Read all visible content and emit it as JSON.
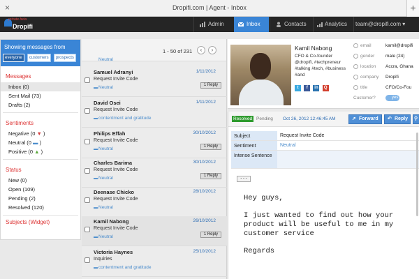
{
  "browser": {
    "title": "Dropifi.com | Agent - Inbox",
    "close": "×",
    "new_tab": "+"
  },
  "logo": {
    "beta": "private beta",
    "word": "Dropifi"
  },
  "nav": {
    "admin": "Admin",
    "inbox": "Inbox",
    "contacts": "Contacts",
    "analytics": "Analytics",
    "account": "team@dropifi.com ▾"
  },
  "sidebar": {
    "heading": "Showing messages from",
    "filters": [
      "everyone",
      "customers",
      "prospects"
    ],
    "messages_title": "Messages",
    "messages": [
      {
        "label": "Inbox",
        "count": "(0)"
      },
      {
        "label": "Sent Mail",
        "count": "(73)"
      },
      {
        "label": "Drafts",
        "count": "(2)"
      }
    ],
    "sentiments_title": "Sentiments",
    "sentiments": [
      {
        "label": "Negative",
        "count": "(0",
        "close": ")"
      },
      {
        "label": "Neutral",
        "count": "(0",
        "close": ")"
      },
      {
        "label": "Positive",
        "count": "(0",
        "close": ")"
      }
    ],
    "status_title": "Status",
    "status": [
      {
        "label": "New",
        "count": "(0)"
      },
      {
        "label": "Open",
        "count": "(109)"
      },
      {
        "label": "Pending",
        "count": "(2)"
      },
      {
        "label": "Resolved",
        "count": "(120)"
      }
    ],
    "subjects_title": "Subjects (Widget)"
  },
  "list": {
    "pager": "1 - 50 of 231",
    "prev": "‹",
    "next": "›",
    "partial_tag": "Neutral",
    "reply_label": "1 Reply",
    "items": [
      {
        "name": "Samuel Adranyi",
        "date": "1/11/2012",
        "subject": "Request Invite Code",
        "tag": "Neutral",
        "reply": true
      },
      {
        "name": "David Osei",
        "date": "1/11/2012",
        "subject": "Request Invite Code",
        "tag": "contentment and gratitude",
        "reply": false
      },
      {
        "name": "Philips Effah",
        "date": "30/10/2012",
        "subject": "Request Invite Code",
        "tag": "Neutral",
        "reply": true
      },
      {
        "name": "Charles Barima",
        "date": "30/10/2012",
        "subject": "Request Invite Code",
        "tag": "Neutral",
        "reply": true
      },
      {
        "name": "Deenase Chicko",
        "date": "28/10/2012",
        "subject": "Request Invite Code",
        "tag": "Neutral",
        "reply": false
      },
      {
        "name": "Kamil Nabong",
        "date": "26/10/2012",
        "subject": "Request Invite Code",
        "tag": "Neutral",
        "reply": true
      },
      {
        "name": "Victoria Haynes",
        "date": "25/10/2012",
        "subject": "Inquiries",
        "tag": "contentment and gratitude",
        "reply": false
      }
    ]
  },
  "profile": {
    "name": "Kamil Nabong",
    "bio": "CFO & Co-founder @dropifi, #techpreneur #talking #tech, #business #and",
    "socials": [
      "t",
      "f",
      "in",
      "Q"
    ],
    "fields": [
      {
        "label": "email",
        "value": "kamil@dropifi"
      },
      {
        "label": "gender",
        "value": "male (24)"
      },
      {
        "label": "location",
        "value": "Accra, Ghana"
      },
      {
        "label": "company",
        "value": "Dropifi"
      },
      {
        "label": "title",
        "value": "CFO/Co-Fou"
      }
    ],
    "customer_label": "Customer?",
    "customer_value": "yes"
  },
  "detail": {
    "status_resolved": "Resolved",
    "status_pending": "Pending",
    "datetime": "Oct 26, 2012 12:46:45 AM",
    "forward": "Forward",
    "reply": "Reply",
    "rows": [
      {
        "key": "Subject",
        "value": "Request Invite Code"
      },
      {
        "key": "Sentiment",
        "value": "Neutral"
      },
      {
        "key": "Intense Sentence",
        "value": ""
      }
    ],
    "expand": "- - -",
    "body": [
      "Hey guys,",
      "I just wanted to find out how your product will be useful to me in my customer service",
      "Regards"
    ]
  },
  "colors": {
    "accent": "#3a85d6",
    "nav_bg": "#252525",
    "resolved": "#2e9b2e",
    "negative": "#d33c3c",
    "neutral": "#4a8ccc",
    "positive": "#5aa83a"
  }
}
